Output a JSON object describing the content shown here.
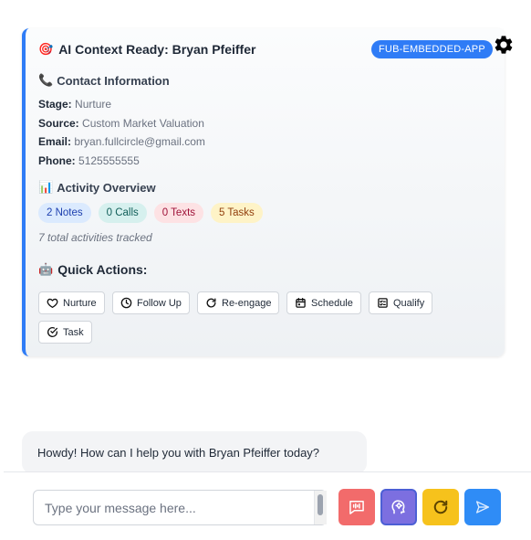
{
  "card": {
    "title_emoji": "🎯",
    "title": "AI Context Ready: Bryan Pfeiffer",
    "badge": "FUB-EMBEDDED-APP",
    "contact": {
      "emoji": "📞",
      "heading": "Contact Information",
      "fields": [
        {
          "label": "Stage:",
          "value": "Nurture"
        },
        {
          "label": "Source:",
          "value": "Custom Market Valuation"
        },
        {
          "label": "Email:",
          "value": "bryan.fullcircle@gmail.com"
        },
        {
          "label": "Phone:",
          "value": "5125555555"
        }
      ]
    },
    "activity": {
      "emoji": "📊",
      "heading": "Activity Overview",
      "pills": [
        {
          "label": "2 Notes",
          "bg": "#dbeafe",
          "fg": "#1e40af"
        },
        {
          "label": "0 Calls",
          "bg": "#d6f0ee",
          "fg": "#115e59"
        },
        {
          "label": "0 Texts",
          "bg": "#fde2e4",
          "fg": "#9f1239"
        },
        {
          "label": "5 Tasks",
          "bg": "#fef3c7",
          "fg": "#92400e"
        }
      ],
      "total": "7 total activities tracked"
    },
    "quick_actions": {
      "emoji": "🤖",
      "heading": "Quick Actions:",
      "buttons": [
        {
          "label": "Nurture",
          "icon": "heart-icon"
        },
        {
          "label": "Follow Up",
          "icon": "clock-icon"
        },
        {
          "label": "Re-engage",
          "icon": "refresh-icon"
        },
        {
          "label": "Schedule",
          "icon": "calendar-icon"
        },
        {
          "label": "Qualify",
          "icon": "checklist-icon"
        },
        {
          "label": "Task",
          "icon": "check-circle-icon"
        }
      ]
    }
  },
  "chat": {
    "assistant_message": "Howdy! How can I help you with Bryan Pfeiffer today?"
  },
  "composer": {
    "placeholder": "Type your message here...",
    "buttons": [
      {
        "name": "voice-button",
        "icon": "audio-message-icon",
        "bg": "#f26b6b"
      },
      {
        "name": "ai-assist-button",
        "icon": "brain-gear-icon",
        "bg": "#7c6fe0"
      },
      {
        "name": "refresh-button",
        "icon": "refresh-icon",
        "bg": "#f6c21c"
      },
      {
        "name": "send-button",
        "icon": "send-icon",
        "bg": "#2f8cf6"
      }
    ]
  },
  "colors": {
    "accent": "#2f7cf6"
  }
}
